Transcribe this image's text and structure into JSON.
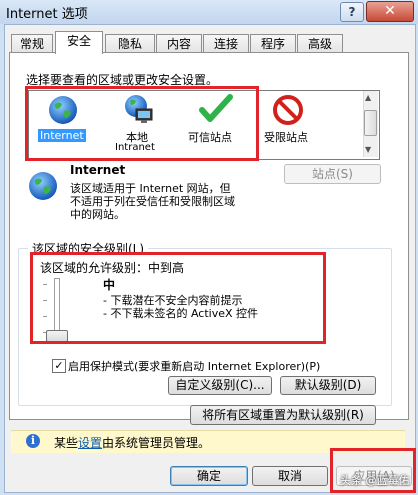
{
  "window": {
    "title": "Internet 选项",
    "help_glyph": "?",
    "close_glyph": "✕"
  },
  "tabs": [
    {
      "label": "常规"
    },
    {
      "label": "安全",
      "active": true
    },
    {
      "label": "隐私"
    },
    {
      "label": "内容"
    },
    {
      "label": "连接"
    },
    {
      "label": "程序"
    },
    {
      "label": "高级"
    }
  ],
  "zones": {
    "prompt": "选择要查看的区域或更改安全设置。",
    "items": [
      {
        "label": "Internet",
        "sublabel": "",
        "icon": "globe-icon",
        "selected": true
      },
      {
        "label": "本地",
        "sublabel": "Intranet",
        "icon": "local-intranet-icon",
        "selected": false
      },
      {
        "label": "可信站点",
        "sublabel": "",
        "icon": "checkmark-icon",
        "selected": false
      },
      {
        "label": "受限站点",
        "sublabel": "",
        "icon": "no-entry-icon",
        "selected": false
      }
    ]
  },
  "zone_info": {
    "title": "Internet",
    "description": "该区域适用于 Internet 网站，但\n不适用于列在受信任和受限制区域\n中的网站。",
    "sites_button": "站点(S)"
  },
  "security_level": {
    "group_label": "该区域的安全级别(L)",
    "allowed_label": "该区域的允许级别：中到高",
    "level_name": "中",
    "bullets": [
      "- 下载潜在不安全内容前提示",
      "- 不下载未签名的 ActiveX 控件"
    ],
    "slider_level": "中",
    "protected_mode_checked": true,
    "protected_mode_label": "启用保护模式(要求重新启动 Internet Explorer)(P)",
    "custom_button": "自定义级别(C)...",
    "default_button": "默认级别(D)",
    "reset_all_button": "将所有区域重置为默认级别(R)"
  },
  "info_bar": {
    "prefix": "某些",
    "link": "设置",
    "suffix": "由系统管理员管理。",
    "icon": "info-icon"
  },
  "footer": {
    "ok": "确定",
    "cancel": "取消",
    "apply": "应用(A)"
  },
  "watermark": "头条 @蓝莓佑",
  "colors": {
    "highlight": "#e0242a",
    "selection": "#3399ff"
  }
}
